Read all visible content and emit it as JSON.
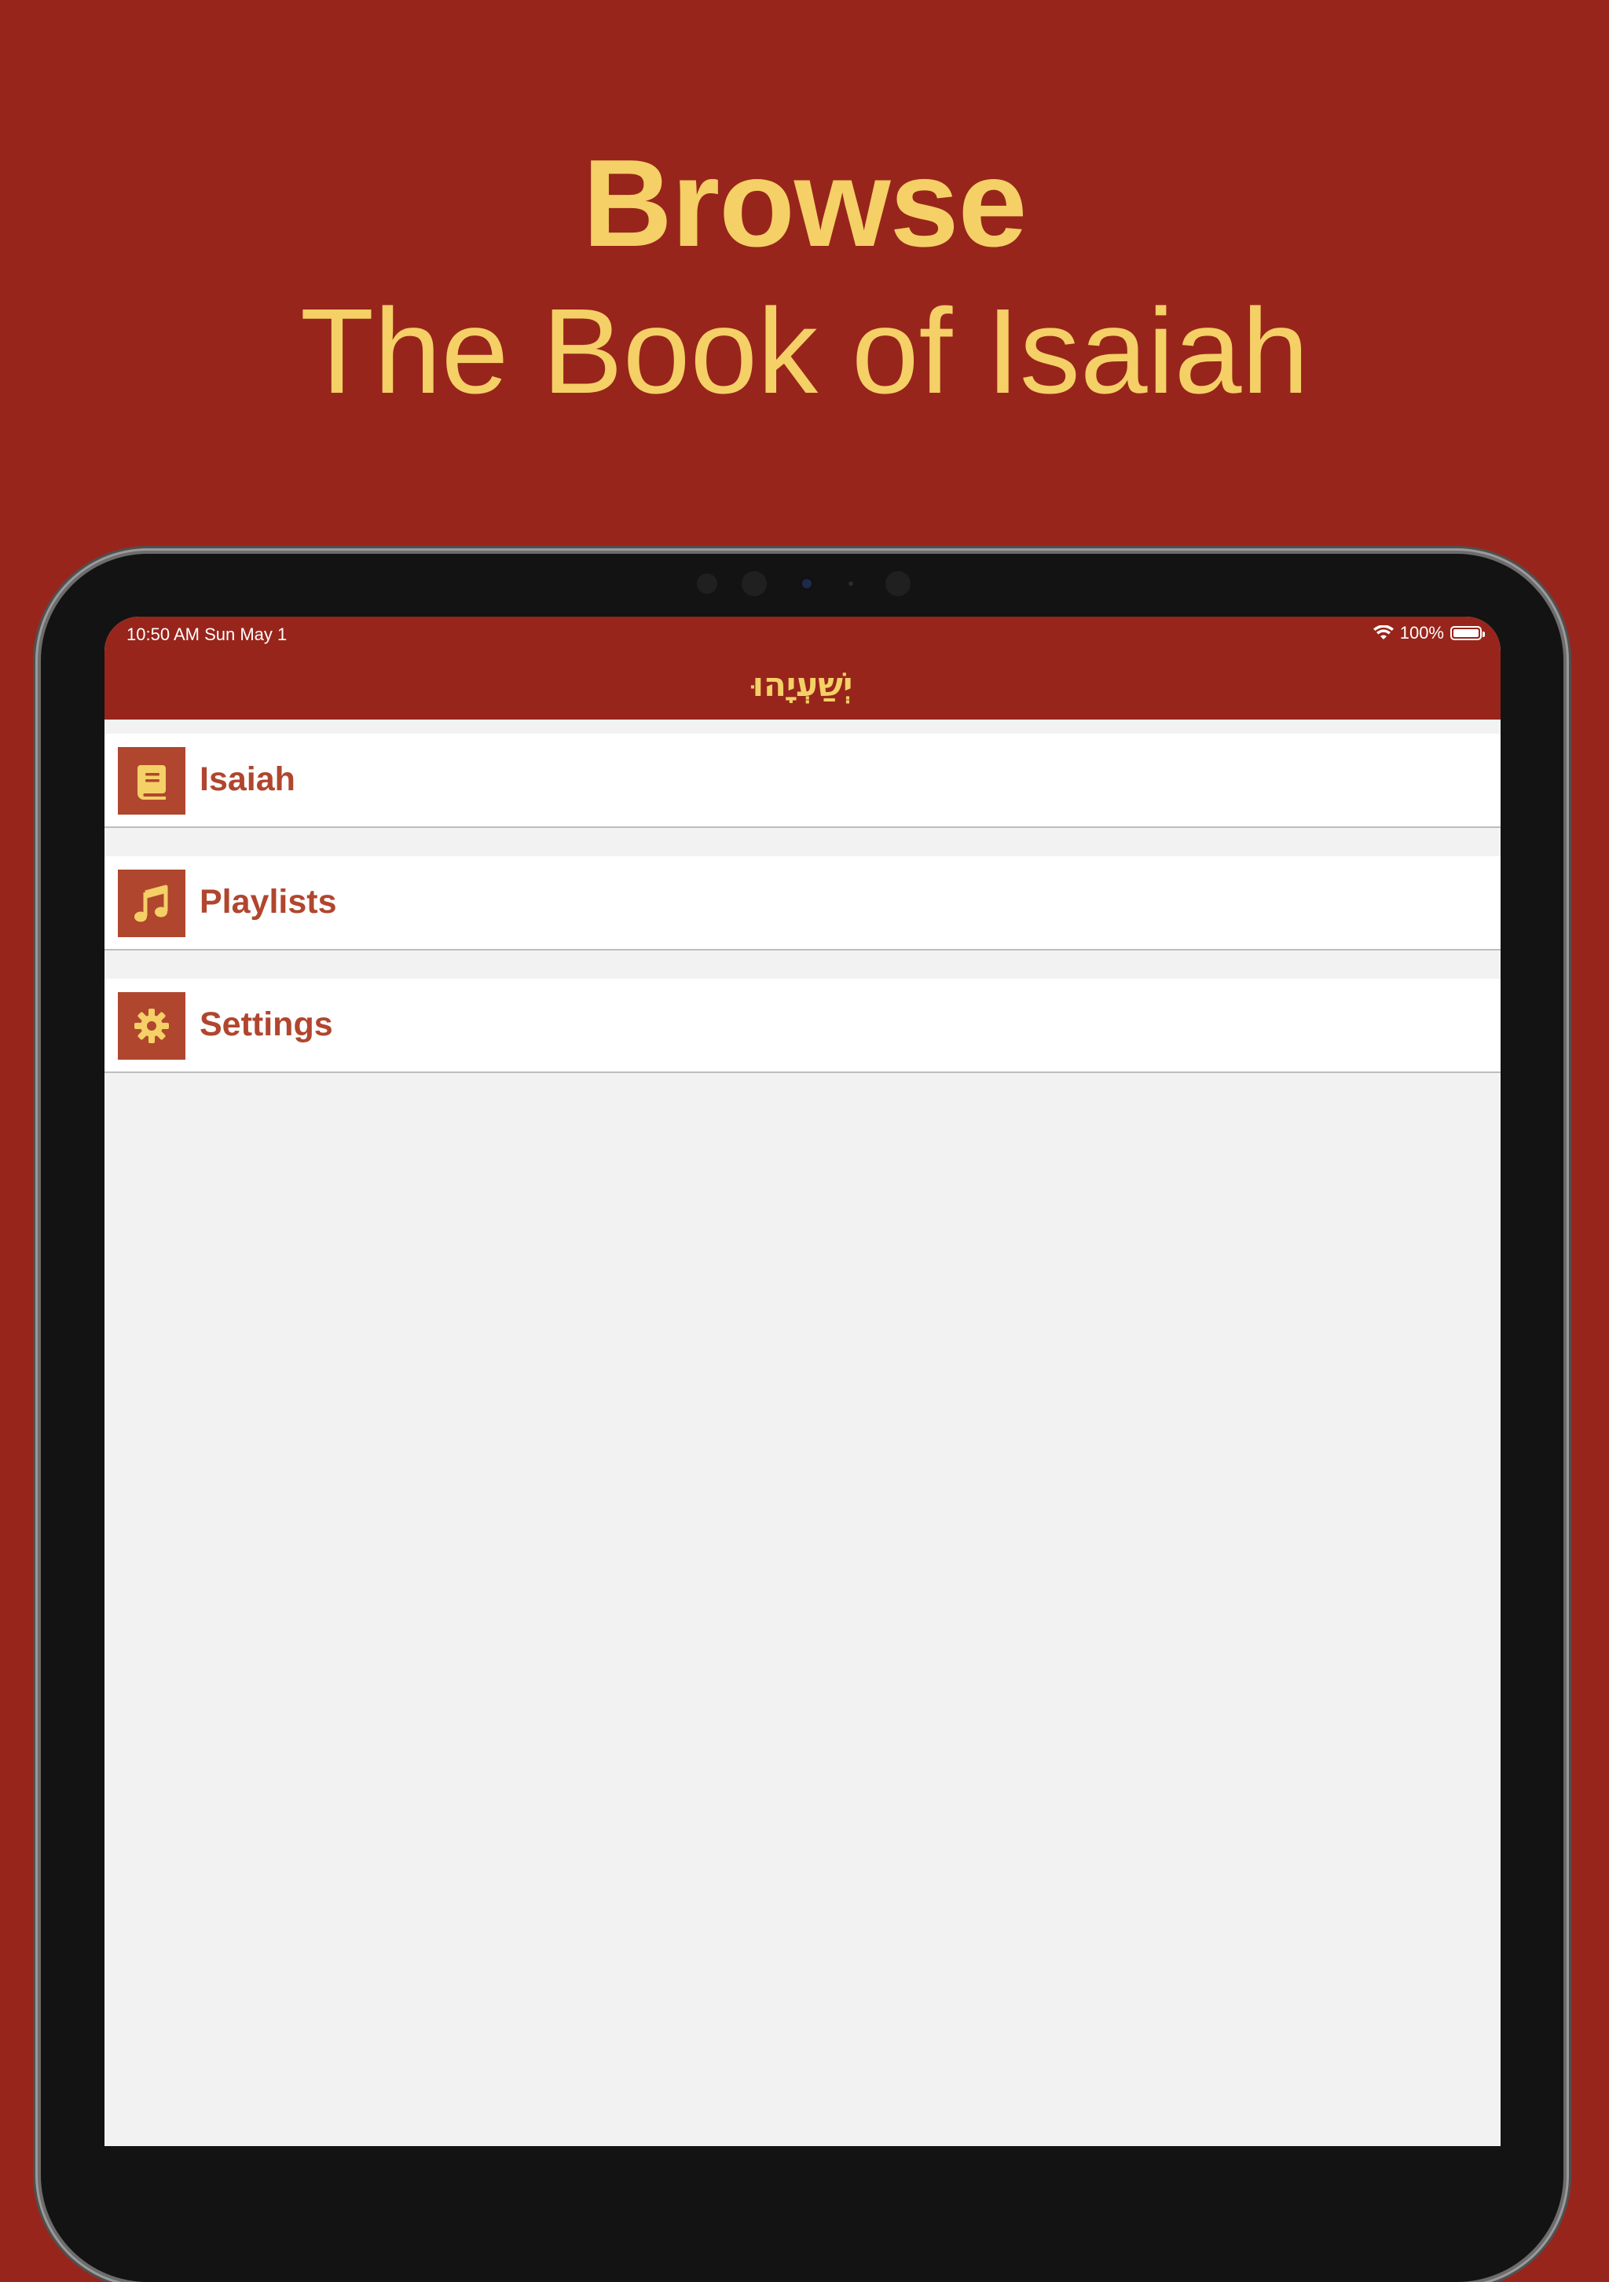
{
  "promo": {
    "headline": "Browse",
    "subheadline": "The Book of Isaiah"
  },
  "status_bar": {
    "time_date": "10:50 AM   Sun May 1",
    "battery_percent": "100%",
    "icons": [
      "wifi-icon",
      "battery-icon"
    ]
  },
  "nav": {
    "title": "יְשַׁעְיָהוּ"
  },
  "menu": {
    "items": [
      {
        "label": "Isaiah",
        "icon": "book-icon"
      },
      {
        "label": "Playlists",
        "icon": "music-note-icon"
      },
      {
        "label": "Settings",
        "icon": "gear-icon"
      }
    ]
  },
  "colors": {
    "background": "#98251b",
    "accent": "#f4d067",
    "icon_tile": "#b0462e",
    "list_background": "#f2f2f2"
  }
}
